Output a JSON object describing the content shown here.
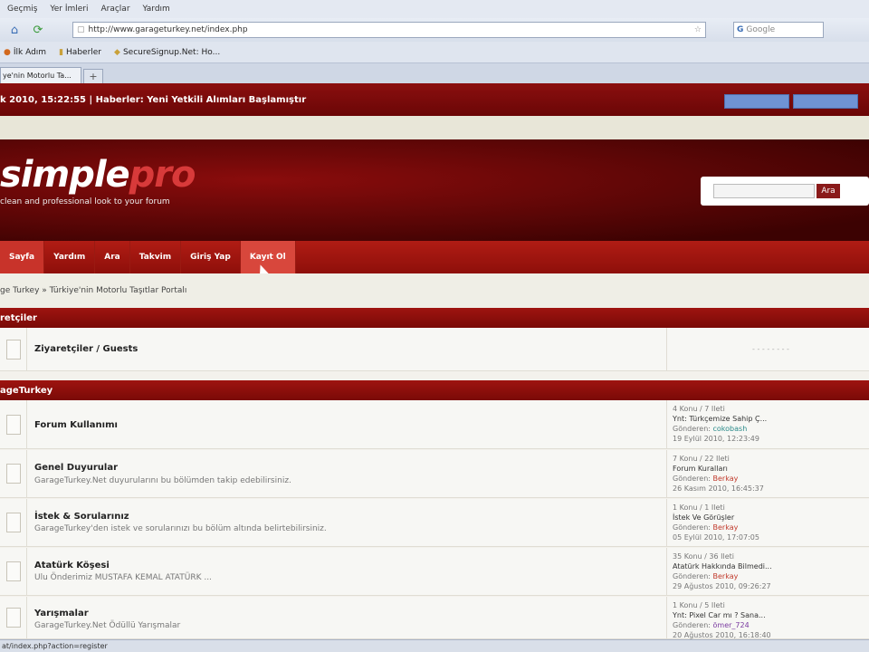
{
  "browser": {
    "menu": [
      "Geçmiş",
      "Yer İmleri",
      "Araçlar",
      "Yardım"
    ],
    "url": "http://www.garageturkey.net/index.php",
    "search_placeholder": "Google",
    "bookmarks": [
      "İlk Adım",
      "Haberler",
      "SecureSignup.Net: Ho..."
    ],
    "tab_label": "ye'nin Motorlu Ta...",
    "new_tab": "+",
    "status_text": "at/index.php?action=register"
  },
  "topbar": {
    "news": "k 2010, 15:22:55  |  Haberler: Yeni Yetkili Alımları Başlamıştır"
  },
  "header": {
    "logo_main": "simple",
    "logo_accent": "pro",
    "tagline": "clean and professional look to your forum",
    "search_button": "Ara"
  },
  "nav": {
    "items": [
      "Sayfa",
      "Yardım",
      "Ara",
      "Takvim",
      "Giriş Yap",
      "Kayıt Ol"
    ]
  },
  "breadcrumb": "ge Turkey » Türkiye'nin Motorlu Taşıtlar Portalı",
  "categories": [
    {
      "title": "retçiler"
    },
    {
      "title": "ageTurkey"
    }
  ],
  "guests_row": {
    "title": "Ziyaretçiler / Guests",
    "last": "- - - - - - - -"
  },
  "boards": [
    {
      "title": "Forum Kullanımı",
      "desc": "",
      "stats": "4 Konu / 7 Ileti",
      "last_title": "Ynt: Türkçemize Sahip Ç...",
      "by_label": "Gönderen:",
      "by": "cokobash",
      "date": "19 Eylül 2010, 12:23:49"
    },
    {
      "title": "Genel Duyurular",
      "desc": "GarageTurkey.Net duyurularını bu bölümden takip edebilirsiniz.",
      "stats": "7 Konu / 22 Ileti",
      "last_title": "Forum Kuralları",
      "by_label": "Gönderen:",
      "by": "Berkay",
      "date": "26 Kasım 2010, 16:45:37"
    },
    {
      "title": "İstek & Sorularınız",
      "desc": "GarageTurkey'den istek ve sorularınızı bu bölüm altında belirtebilirsiniz.",
      "stats": "1 Konu / 1 Ileti",
      "last_title": "İstek Ve Görüşler",
      "by_label": "Gönderen:",
      "by": "Berkay",
      "date": "05 Eylül 2010, 17:07:05"
    },
    {
      "title": "Atatürk Köşesi",
      "desc": "Ulu Önderimiz MUSTAFA KEMAL ATATÜRK ...",
      "stats": "35 Konu / 36 Ileti",
      "last_title": "Atatürk Hakkında Bilmedi...",
      "by_label": "Gönderen:",
      "by": "Berkay",
      "date": "29 Ağustos 2010, 09:26:27"
    },
    {
      "title": "Yarışmalar",
      "desc": "GarageTurkey.Net Ödüllü Yarışmalar",
      "stats": "1 Konu / 5 Ileti",
      "last_title": "Ynt: Pixel Car mı ? Sana...",
      "by_label": "Gönderen:",
      "by": "ömer_724",
      "date": "20 Ağustos 2010, 16:18:40"
    }
  ]
}
